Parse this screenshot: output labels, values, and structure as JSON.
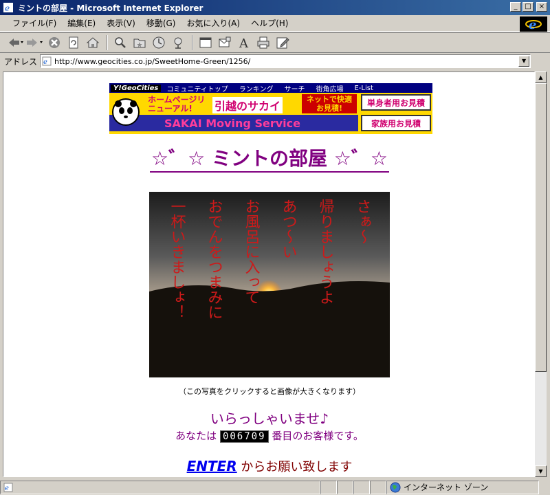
{
  "window": {
    "title": "ミントの部屋 - Microsoft Internet Explorer",
    "minimize": "_",
    "maximize": "□",
    "close": "×"
  },
  "menu": [
    "ファイル(F)",
    "編集(E)",
    "表示(V)",
    "移動(G)",
    "お気に入り(A)",
    "ヘルプ(H)"
  ],
  "toolbar": {
    "buttons": [
      "back-icon",
      "forward-icon",
      "stop-icon",
      "refresh-icon",
      "home-icon",
      "search-icon",
      "favorites-icon",
      "history-icon",
      "channels-icon",
      "fullscreen-icon",
      "mail-icon",
      "font-icon",
      "print-icon",
      "edit-icon"
    ]
  },
  "address": {
    "label": "アドレス",
    "url": "http://www.geocities.co.jp/SweetHome-Green/1256/"
  },
  "banner": {
    "logo": "Y!GeoCities",
    "links": [
      "コミュニティトップ",
      "ランキング",
      "サーチ",
      "街角広場",
      "E-List"
    ],
    "ad_line1": "ホームページリニューアル!",
    "ad_line2": "引越のサカイ",
    "ad_line3": "ネットで快適お見積!",
    "ad_button1": "単身者用お見積",
    "ad_button2": "家族用お見積",
    "ad_footer": "SAKAI Moving Service"
  },
  "page": {
    "title": "☆゛☆ ミントの部屋 ☆゛☆",
    "photo_lines": [
      "さぁ～",
      "帰りましょうよ",
      "あつ～い",
      "お風呂に入って",
      "おでんをつまみに",
      "一杯いきましょ！"
    ],
    "caption": "（この写真をクリックすると画像が大きくなります）",
    "welcome": "いらっしゃいませ♪",
    "counter_prefix": "あなたは",
    "counter_value": "006709",
    "counter_suffix": "番目のお客様です。",
    "enter_label": "ENTER",
    "enter_suffix": " からお願い致します"
  },
  "status": {
    "zone": "インターネット ゾーン"
  },
  "colors": {
    "title_purple": "#800080",
    "link_blue": "#0000ee",
    "enter_brown": "#800000"
  }
}
